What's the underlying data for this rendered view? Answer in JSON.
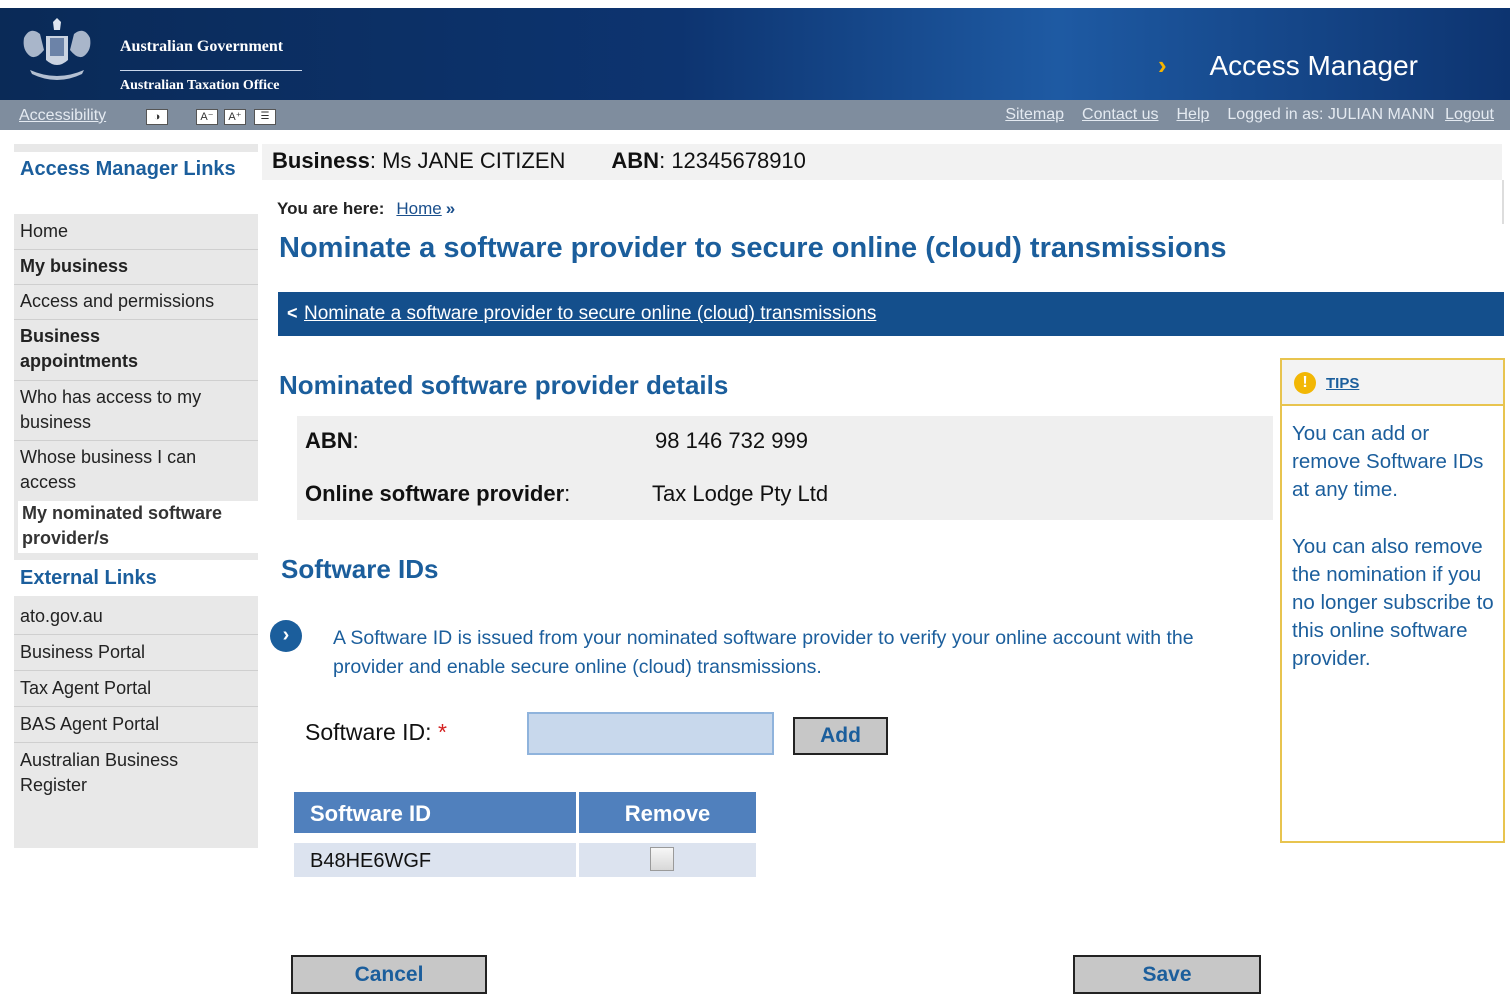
{
  "header": {
    "gov_line1": "Australian Government",
    "gov_line2": "Australian Taxation Office",
    "app_title": "Access Manager",
    "chevron": "›"
  },
  "toolbar": {
    "accessibility": "Accessibility",
    "contrast_icon": "contrast-icon",
    "font_smaller": "A⁻",
    "font_larger": "A⁺",
    "text_view_icon": "text-view-icon",
    "sitemap": "Sitemap",
    "contact": "Contact us",
    "help": "Help",
    "logged_in": "Logged in as: JULIAN MANN",
    "logout": "Logout"
  },
  "sidebar": {
    "heading_access": "Access Manager Links",
    "home": "Home",
    "my_business": "My business",
    "access_permissions": "Access and permissions",
    "business_appointments": "Business appointments",
    "who_has_access": "Who has access to my business",
    "whose_business": "Whose business I can access",
    "my_nominated": "My nominated software provider/s",
    "heading_external": "External Links",
    "ato": "ato.gov.au",
    "business_portal": "Business Portal",
    "tax_agent_portal": "Tax Agent Portal",
    "bas_agent_portal": "BAS Agent Portal",
    "abr": "Australian Business Register"
  },
  "business_bar": {
    "business_label": "Business",
    "business_value": "Ms JANE CITIZEN",
    "abn_label": "ABN",
    "abn_value": "12345678910"
  },
  "breadcrumb": {
    "label": "You are here:",
    "home": "Home",
    "sep": "»"
  },
  "page": {
    "title": "Nominate a software provider to secure online (cloud) transmissions",
    "back_marker": "<",
    "back_link": "Nominate a software provider to secure online (cloud) transmissions"
  },
  "details": {
    "heading": "Nominated software provider details",
    "abn_label": "ABN",
    "abn_value": "98 146 732 999",
    "provider_label": "Online software provider",
    "provider_value": "Tax Lodge Pty Ltd"
  },
  "software_ids": {
    "heading": "Software IDs",
    "info_icon": "chevron-right-icon",
    "info_text": "A Software ID is issued from your nominated software provider to verify your online account with the provider and enable secure online (cloud) transmissions.",
    "input_label": "Software ID:",
    "required_mark": "*",
    "input_value": "",
    "add_label": "Add",
    "table": {
      "columns": [
        "Software ID",
        "Remove"
      ],
      "rows": [
        {
          "software_id": "B48HE6WGF",
          "remove_checked": false
        }
      ]
    }
  },
  "actions": {
    "cancel": "Cancel",
    "save": "Save"
  },
  "tips": {
    "icon": "!",
    "title": "TIPS",
    "p1": "You can add or remove Software IDs at any time.",
    "p2": "You can also remove the nomination if you no longer subscribe to this online software provider."
  }
}
